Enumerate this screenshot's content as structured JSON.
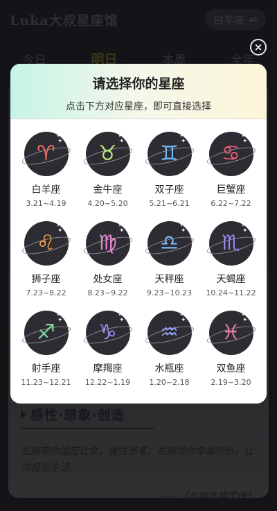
{
  "app": {
    "title": "Luka大叔星座馆",
    "switch_label": "白羊座",
    "switch_icon": "⇌"
  },
  "tabs": [
    "今日",
    "明日",
    "本周",
    "全年"
  ],
  "background_card": {
    "motto_title": "感性·想象·创造",
    "motto_text": "左脑带你适应社会，理性思考；右脑给你幸福快乐，让你轻松生活。",
    "motto_source": "——《右脑幸福定律》"
  },
  "modal": {
    "title": "请选择你的星座",
    "subtitle": "点击下方对应星座，即可直接选择",
    "close_icon": "×",
    "signs": [
      {
        "name": "白羊座",
        "dates": "3.21~4.19",
        "glyph": "♈",
        "color": "#f26b5b"
      },
      {
        "name": "金牛座",
        "dates": "4.20~5.20",
        "glyph": "♉",
        "color": "#b9e77a"
      },
      {
        "name": "双子座",
        "dates": "5.21~6.21",
        "glyph": "♊",
        "color": "#6fb7f5"
      },
      {
        "name": "巨蟹座",
        "dates": "6.22~7.22",
        "glyph": "♋",
        "color": "#f0627a"
      },
      {
        "name": "狮子座",
        "dates": "7.23~8.22",
        "glyph": "♌",
        "color": "#f3a046"
      },
      {
        "name": "处女座",
        "dates": "8.23~9.22",
        "glyph": "♍",
        "color": "#e58ad2"
      },
      {
        "name": "天秤座",
        "dates": "9.23~10.23",
        "glyph": "♎",
        "color": "#79b8f7"
      },
      {
        "name": "天蝎座",
        "dates": "10.24~11.22",
        "glyph": "♏",
        "color": "#9a86f3"
      },
      {
        "name": "射手座",
        "dates": "11.23~12.21",
        "glyph": "♐",
        "color": "#7ad79e"
      },
      {
        "name": "摩羯座",
        "dates": "12.22~1.19",
        "glyph": "♑",
        "color": "#9f8cf0"
      },
      {
        "name": "水瓶座",
        "dates": "1.20~2.18",
        "glyph": "♒",
        "color": "#8fa2f4"
      },
      {
        "name": "双鱼座",
        "dates": "2.19~3.20",
        "glyph": "♓",
        "color": "#f07aa8"
      }
    ]
  }
}
